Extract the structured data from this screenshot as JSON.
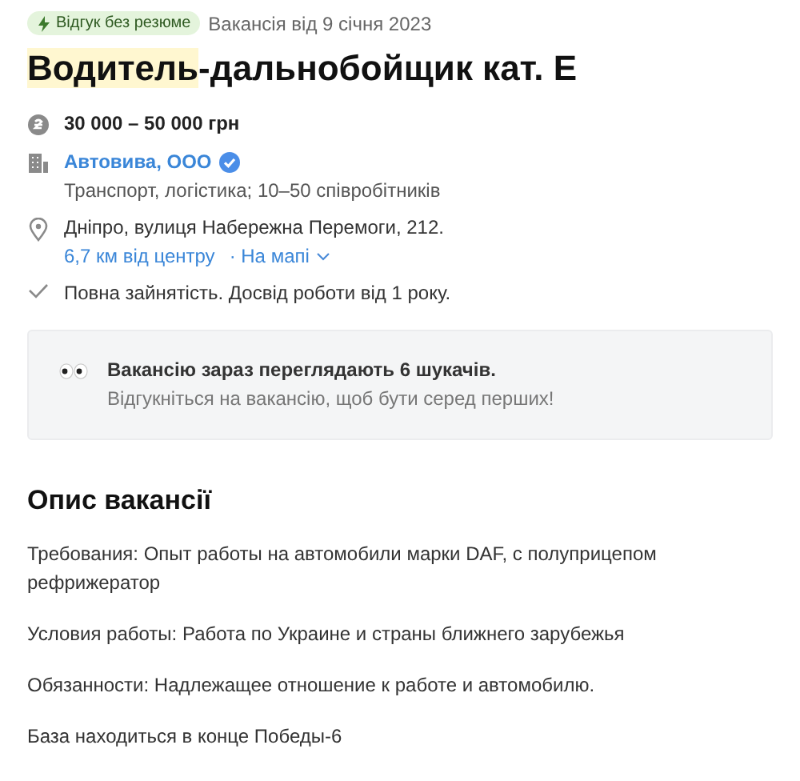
{
  "badge": {
    "label": "Відгук без резюме"
  },
  "posted": "Вакансія від 9 січня 2023",
  "title": [
    {
      "text": "Водитель",
      "highlighted": true
    },
    {
      "text": "-дальнобойщик кат. Е",
      "highlighted": false
    }
  ],
  "salary": "30 000 – 50 000 грн",
  "company": {
    "name": "Автовива, ООО",
    "verified": true,
    "details": "Транспорт, логістика; 10–50 співробітників"
  },
  "address": {
    "text": "Дніпро, вулиця Набережна Перемоги, 212.",
    "distance": "6,7 км від центру",
    "map_link": "· На мапі"
  },
  "conditions": "Повна зайнятість. Досвід роботи від 1 року.",
  "notice": {
    "title": "Вакансію зараз переглядають 6 шукачів.",
    "text": "Відгукніться на вакансію, щоб бути серед перших!"
  },
  "description": {
    "heading": "Опис вакансії",
    "paragraphs": [
      "Требования: Опыт работы на автомобили марки DAF, с полуприцепом рефрижератор",
      "Условия работы: Работа по Украине и страны ближнего зарубежья",
      "Обязанности: Надлежащее отношение к работе и автомобилю.",
      "База находиться в конце Победы-6"
    ]
  }
}
